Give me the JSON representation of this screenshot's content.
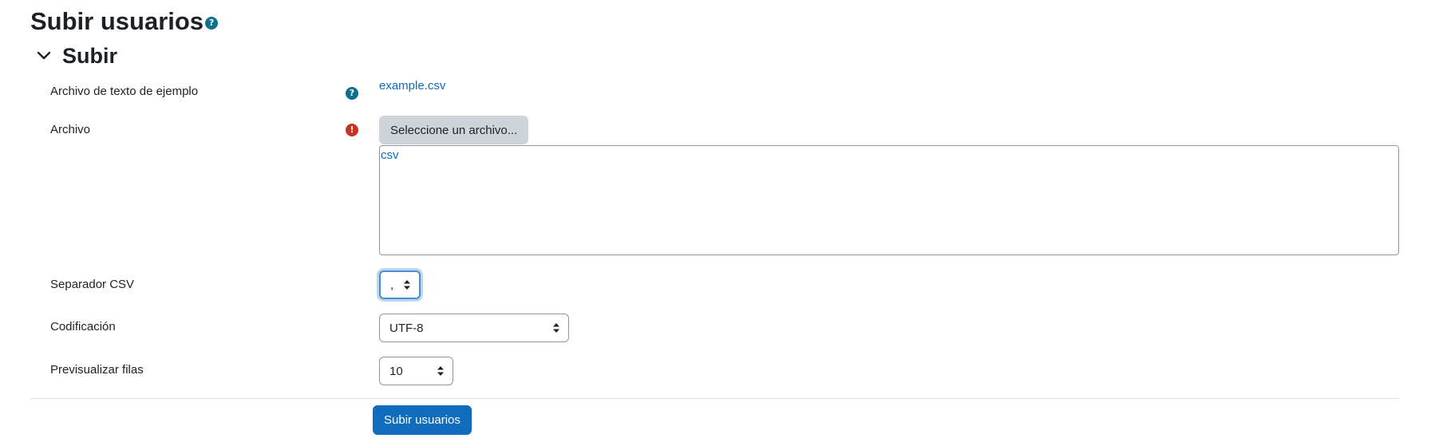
{
  "header": {
    "title": "Subir usuarios",
    "help_icon": "help-icon"
  },
  "section": {
    "title": "Subir",
    "chevron_icon": "chevron-down-icon"
  },
  "form": {
    "example_file": {
      "label": "Archivo de texto de ejemplo",
      "icon": "help-icon",
      "link_text": "example.csv"
    },
    "file": {
      "label": "Archivo",
      "icon": "required-icon",
      "button_label": "Seleccione un archivo...",
      "accepted_types_link": "csv"
    },
    "csv_separator": {
      "label": "Separador CSV",
      "selected": ","
    },
    "encoding": {
      "label": "Codificación",
      "selected": "UTF-8"
    },
    "preview_rows": {
      "label": "Previsualizar filas",
      "selected": "10"
    },
    "submit_label": "Subir usuarios"
  },
  "colors": {
    "primary": "#0f6cbf",
    "help_icon": "#0f6f8f",
    "required_icon": "#ca3120",
    "secondary_button": "#ced4da"
  }
}
